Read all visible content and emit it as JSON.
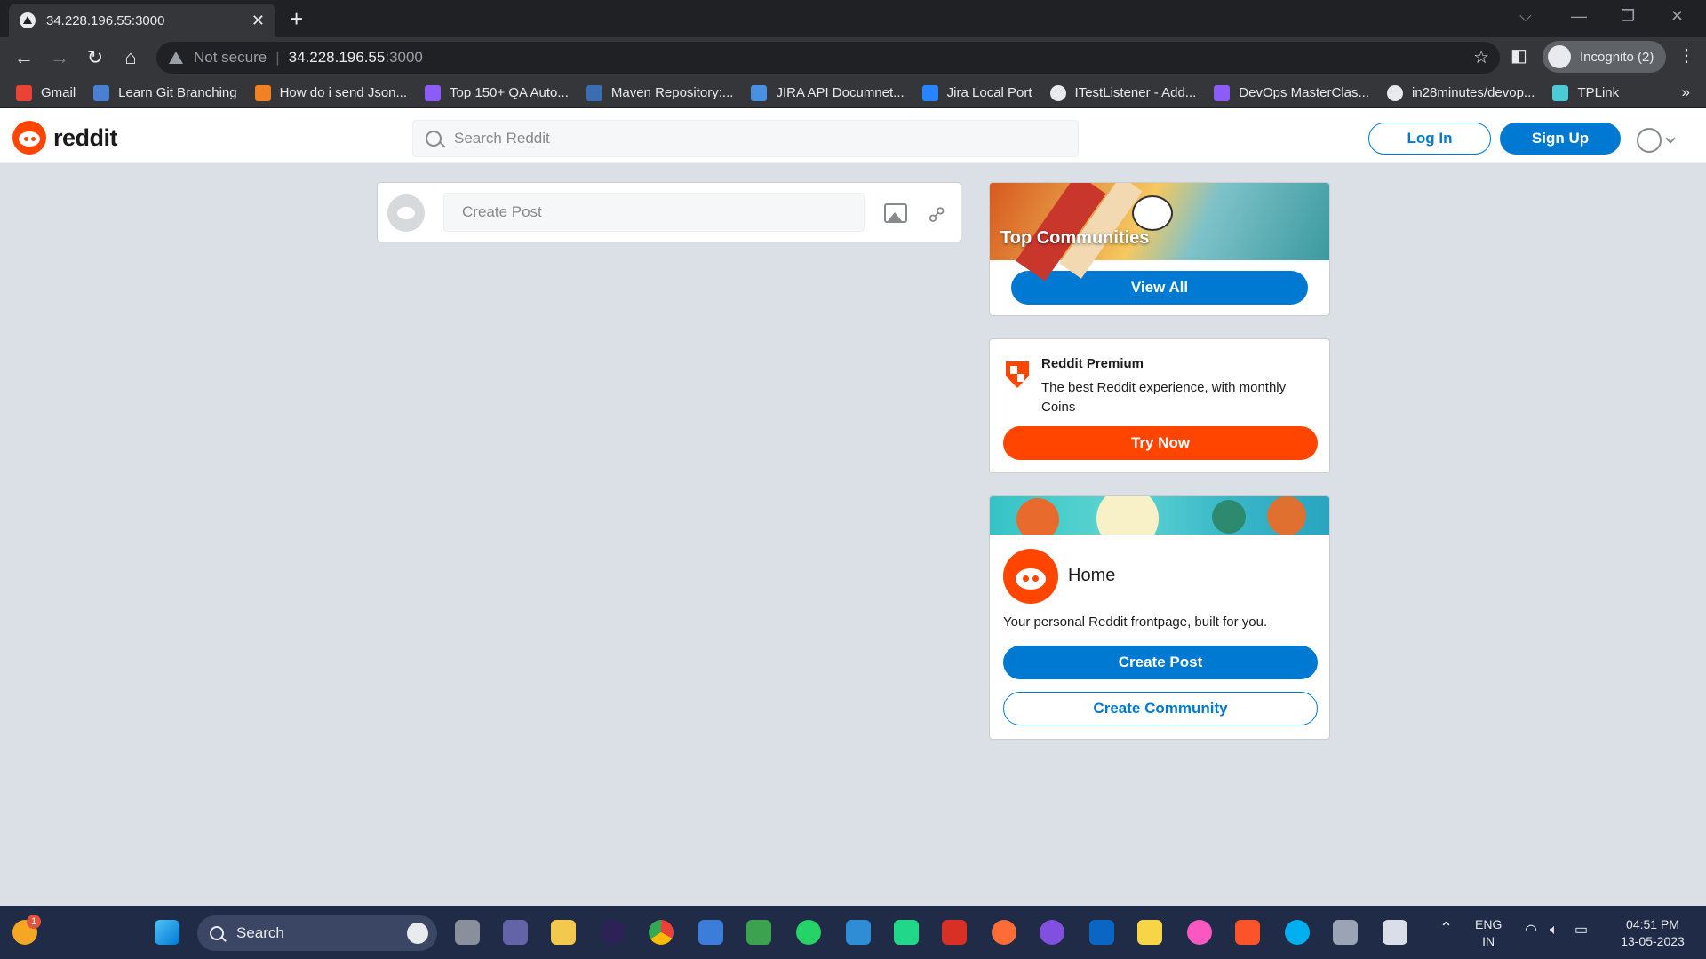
{
  "browser": {
    "tab_title": "34.228.196.55:3000",
    "address_security": "Not secure",
    "address_host": "34.228.196.55",
    "address_port": ":3000",
    "incognito_label": "Incognito (2)",
    "bookmarks": [
      {
        "label": "Gmail",
        "color": "#ea4335"
      },
      {
        "label": "Learn Git Branching",
        "color": "#4a7fd4"
      },
      {
        "label": "How do i send Json...",
        "color": "#f48024"
      },
      {
        "label": "Top 150+ QA Auto...",
        "color": "#8b5cf6"
      },
      {
        "label": "Maven Repository:...",
        "color": "#3b6db3"
      },
      {
        "label": "JIRA API Documnet...",
        "color": "#4a90e2"
      },
      {
        "label": "Jira Local Port",
        "color": "#2684ff"
      },
      {
        "label": "ITestListener - Add...",
        "color": "#e8eaed"
      },
      {
        "label": "DevOps MasterClas...",
        "color": "#8b5cf6"
      },
      {
        "label": "in28minutes/devop...",
        "color": "#e8eaed"
      },
      {
        "label": "TPLink",
        "color": "#4acbd6"
      }
    ]
  },
  "header": {
    "logo_text": "reddit",
    "search_placeholder": "Search Reddit",
    "login_label": "Log In",
    "signup_label": "Sign Up"
  },
  "create_post": {
    "placeholder": "Create Post"
  },
  "top_communities": {
    "title": "Top Communities",
    "button_label": "View All"
  },
  "premium": {
    "title": "Reddit Premium",
    "description": "The best Reddit experience, with monthly Coins",
    "button_label": "Try Now"
  },
  "home": {
    "title": "Home",
    "description": "Your personal Reddit frontpage, built for you.",
    "create_post_label": "Create Post",
    "create_community_label": "Create Community"
  },
  "taskbar": {
    "search_label": "Search",
    "notification_count": "1",
    "lang_line1": "ENG",
    "lang_line2": "IN",
    "time": "04:51 PM",
    "date": "13-05-2023"
  },
  "colors": {
    "reddit_orange": "#ff4500",
    "reddit_blue": "#0079d3",
    "page_bg": "#dae0e6"
  }
}
